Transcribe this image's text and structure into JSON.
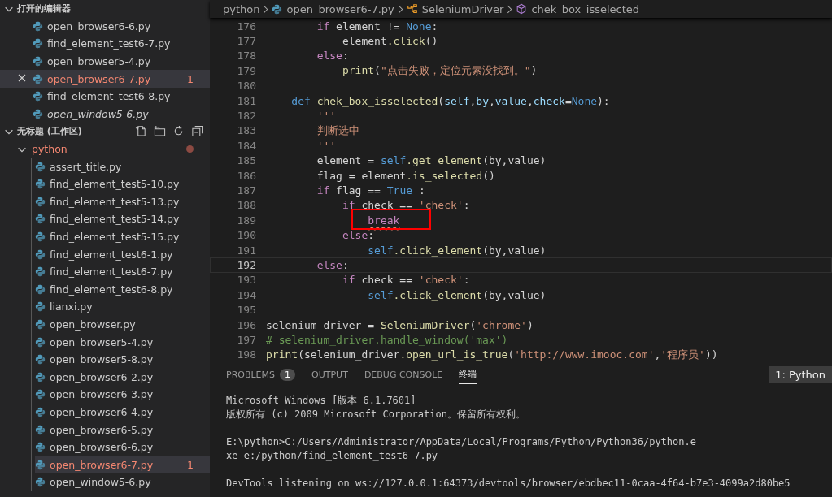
{
  "sidebar": {
    "open_editors": {
      "title": "打开的编辑器",
      "expanded": true,
      "items": [
        {
          "name": "open_browser6-6.py",
          "selected": false,
          "error": false,
          "preview": false
        },
        {
          "name": "find_element_test6-7.py",
          "selected": false,
          "error": false,
          "preview": false
        },
        {
          "name": "open_browser5-4.py",
          "selected": false,
          "error": false,
          "preview": false
        },
        {
          "name": "open_browser6-7.py",
          "selected": true,
          "error": true,
          "preview": false,
          "count": "1"
        },
        {
          "name": "find_element_test6-8.py",
          "selected": false,
          "error": false,
          "preview": false
        },
        {
          "name": "open_window5-6.py",
          "selected": false,
          "error": false,
          "preview": true
        }
      ]
    },
    "workspace": {
      "title": "无标题 (工作区)",
      "expanded": true,
      "folder": {
        "name": "python",
        "expanded": true,
        "error": true,
        "children": [
          {
            "name": "assert_title.py",
            "selected": false,
            "error": false
          },
          {
            "name": "find_element_test5-10.py",
            "selected": false,
            "error": false
          },
          {
            "name": "find_element_test5-13.py",
            "selected": false,
            "error": false
          },
          {
            "name": "find_element_test5-14.py",
            "selected": false,
            "error": false
          },
          {
            "name": "find_element_test5-15.py",
            "selected": false,
            "error": false
          },
          {
            "name": "find_element_test6-1.py",
            "selected": false,
            "error": false
          },
          {
            "name": "find_element_test6-7.py",
            "selected": false,
            "error": false
          },
          {
            "name": "find_element_test6-8.py",
            "selected": false,
            "error": false
          },
          {
            "name": "lianxi.py",
            "selected": false,
            "error": false
          },
          {
            "name": "open_browser.py",
            "selected": false,
            "error": false
          },
          {
            "name": "open_browser5-4.py",
            "selected": false,
            "error": false
          },
          {
            "name": "open_browser5-8.py",
            "selected": false,
            "error": false
          },
          {
            "name": "open_browser6-2.py",
            "selected": false,
            "error": false
          },
          {
            "name": "open_browser6-3.py",
            "selected": false,
            "error": false
          },
          {
            "name": "open_browser6-4.py",
            "selected": false,
            "error": false
          },
          {
            "name": "open_browser6-5.py",
            "selected": false,
            "error": false
          },
          {
            "name": "open_browser6-6.py",
            "selected": false,
            "error": false
          },
          {
            "name": "open_browser6-7.py",
            "selected": true,
            "error": true,
            "count": "1"
          },
          {
            "name": "open_window5-6.py",
            "selected": false,
            "error": false
          }
        ]
      }
    }
  },
  "breadcrumb": [
    {
      "kind": "folder",
      "label": "python"
    },
    {
      "kind": "file",
      "label": "open_browser6-7.py"
    },
    {
      "kind": "class",
      "label": "SeleniumDriver"
    },
    {
      "kind": "method",
      "label": "chek_box_isselected"
    }
  ],
  "editor": {
    "lines": [
      {
        "number": "176",
        "current": false,
        "tokens": [
          {
            "kind": "kw",
            "text": "        if"
          },
          {
            "kind": "plain",
            "text": " element != "
          },
          {
            "kind": "const",
            "text": "None"
          },
          {
            "kind": "plain",
            "text": ":"
          }
        ]
      },
      {
        "number": "177",
        "current": false,
        "tokens": [
          {
            "kind": "plain",
            "text": "            element"
          },
          {
            "kind": "fn",
            "text": ".click"
          },
          {
            "kind": "plain",
            "text": "()"
          }
        ]
      },
      {
        "number": "178",
        "current": false,
        "tokens": [
          {
            "kind": "kw",
            "text": "        else"
          },
          {
            "kind": "plain",
            "text": ":"
          }
        ]
      },
      {
        "number": "179",
        "current": false,
        "tokens": [
          {
            "kind": "fn",
            "text": "            print"
          },
          {
            "kind": "plain",
            "text": "("
          },
          {
            "kind": "str",
            "text": "\"点击失败，定位元素没找到。\""
          },
          {
            "kind": "plain",
            "text": ")"
          }
        ]
      },
      {
        "number": "180",
        "current": false
      },
      {
        "number": "181",
        "current": false,
        "tokens": [
          {
            "kind": "const",
            "text": "    def"
          },
          {
            "kind": "fn",
            "text": " chek_box_isselected"
          },
          {
            "kind": "plain",
            "text": "("
          },
          {
            "kind": "param",
            "text": "self"
          },
          {
            "kind": "plain",
            "text": ","
          },
          {
            "kind": "param",
            "text": "by"
          },
          {
            "kind": "plain",
            "text": ","
          },
          {
            "kind": "param",
            "text": "value"
          },
          {
            "kind": "plain",
            "text": ","
          },
          {
            "kind": "param",
            "text": "check"
          },
          {
            "kind": "plain",
            "text": "="
          },
          {
            "kind": "const",
            "text": "None"
          },
          {
            "kind": "plain",
            "text": "):"
          }
        ]
      },
      {
        "number": "182",
        "current": false,
        "tokens": [
          {
            "kind": "str",
            "text": "        '''"
          }
        ]
      },
      {
        "number": "183",
        "current": false,
        "tokens": [
          {
            "kind": "str",
            "text": "        判断选中"
          }
        ]
      },
      {
        "number": "184",
        "current": false,
        "tokens": [
          {
            "kind": "str",
            "text": "        '''"
          }
        ]
      },
      {
        "number": "185",
        "current": false,
        "tokens": [
          {
            "kind": "plain",
            "text": "        element = "
          },
          {
            "kind": "const",
            "text": "self"
          },
          {
            "kind": "fn",
            "text": ".get_element"
          },
          {
            "kind": "plain",
            "text": "(by,value)"
          }
        ]
      },
      {
        "number": "186",
        "current": false,
        "tokens": [
          {
            "kind": "plain",
            "text": "        flag = element"
          },
          {
            "kind": "fn",
            "text": ".is_selected"
          },
          {
            "kind": "plain",
            "text": "()"
          }
        ]
      },
      {
        "number": "187",
        "current": false,
        "tokens": [
          {
            "kind": "kw",
            "text": "        if"
          },
          {
            "kind": "plain",
            "text": " flag == "
          },
          {
            "kind": "const",
            "text": "True"
          },
          {
            "kind": "plain",
            "text": " :"
          }
        ]
      },
      {
        "number": "188",
        "current": false,
        "tokens": [
          {
            "kind": "kw",
            "text": "            if"
          },
          {
            "kind": "plain",
            "text": " check == "
          },
          {
            "kind": "str",
            "text": "'check'"
          },
          {
            "kind": "plain",
            "text": ":"
          }
        ]
      },
      {
        "number": "189",
        "current": false,
        "tokens": [
          {
            "kind": "error",
            "text": "                break"
          }
        ]
      },
      {
        "number": "190",
        "current": false,
        "tokens": [
          {
            "kind": "kw",
            "text": "            else"
          },
          {
            "kind": "plain",
            "text": ":"
          }
        ]
      },
      {
        "number": "191",
        "current": false,
        "tokens": [
          {
            "kind": "const",
            "text": "                self"
          },
          {
            "kind": "fn",
            "text": ".click_element"
          },
          {
            "kind": "plain",
            "text": "(by,value)"
          }
        ]
      },
      {
        "number": "192",
        "current": true,
        "tokens": [
          {
            "kind": "kw",
            "text": "        else"
          },
          {
            "kind": "plain",
            "text": ":"
          }
        ]
      },
      {
        "number": "193",
        "current": false,
        "tokens": [
          {
            "kind": "kw",
            "text": "            if"
          },
          {
            "kind": "plain",
            "text": " check == "
          },
          {
            "kind": "str",
            "text": "'check'"
          },
          {
            "kind": "plain",
            "text": ":"
          }
        ]
      },
      {
        "number": "194",
        "current": false,
        "tokens": [
          {
            "kind": "const",
            "text": "                self"
          },
          {
            "kind": "fn",
            "text": ".click_element"
          },
          {
            "kind": "plain",
            "text": "(by,value)"
          }
        ]
      },
      {
        "number": "195",
        "current": false
      },
      {
        "number": "196",
        "current": false,
        "tokens": [
          {
            "kind": "plain",
            "text": "selenium_driver = "
          },
          {
            "kind": "fn",
            "text": "SeleniumDriver"
          },
          {
            "kind": "plain",
            "text": "("
          },
          {
            "kind": "str",
            "text": "'chrome'"
          },
          {
            "kind": "plain",
            "text": ")"
          }
        ]
      },
      {
        "number": "197",
        "current": false,
        "tokens": [
          {
            "kind": "comment",
            "text": "# selenium_driver.handle_window('max')"
          }
        ]
      },
      {
        "number": "198",
        "current": false,
        "tokens": [
          {
            "kind": "fn",
            "text": "print"
          },
          {
            "kind": "plain",
            "text": "(selenium_driver"
          },
          {
            "kind": "fn",
            "text": ".open_url_is_true"
          },
          {
            "kind": "plain",
            "text": "("
          },
          {
            "kind": "str",
            "text": "'http://www.imooc.com'"
          },
          {
            "kind": "plain",
            "text": ","
          },
          {
            "kind": "str",
            "text": "'程序员'"
          },
          {
            "kind": "plain",
            "text": "))"
          }
        ]
      }
    ]
  },
  "panel": {
    "tabs": [
      {
        "label": "PROBLEMS",
        "selected": false,
        "badge": "1"
      },
      {
        "label": "OUTPUT",
        "selected": false
      },
      {
        "label": "DEBUG CONSOLE",
        "selected": false
      },
      {
        "label": "终端",
        "selected": true
      }
    ],
    "terminal_select": "1: Python",
    "terminal": [
      [
        "Microsoft Windows [版本 6.1.7601]",
        "版权所有 (c) 2009 Microsoft Corporation。保留所有权利。"
      ],
      [
        "E:\\python>C:/Users/Administrator/AppData/Local/Programs/Python/Python36/python.e",
        "xe e:/python/find_element_test6-7.py"
      ],
      [
        "DevTools listening on ws://127.0.0.1:64373/devtools/browser/ebdbec11-0caa-4f64-b7e3-4099a2d80be5"
      ]
    ]
  }
}
